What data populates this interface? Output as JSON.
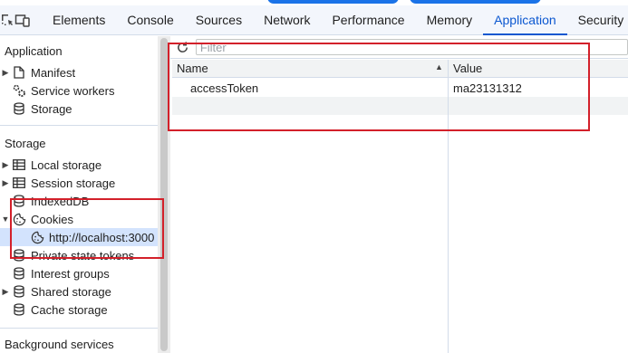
{
  "tabs": [
    {
      "label": "Elements"
    },
    {
      "label": "Console"
    },
    {
      "label": "Sources"
    },
    {
      "label": "Network"
    },
    {
      "label": "Performance"
    },
    {
      "label": "Memory"
    },
    {
      "label": "Application",
      "active": true
    },
    {
      "label": "Security"
    }
  ],
  "sidebar": {
    "application_title": "Application",
    "application_items": [
      {
        "label": "Manifest",
        "icon": "file-icon"
      },
      {
        "label": "Service workers",
        "icon": "gears-icon"
      },
      {
        "label": "Storage",
        "icon": "database-icon"
      }
    ],
    "storage_title": "Storage",
    "storage_items": [
      {
        "label": "Local storage",
        "icon": "table-icon"
      },
      {
        "label": "Session storage",
        "icon": "table-icon"
      },
      {
        "label": "IndexedDB",
        "icon": "database-icon"
      },
      {
        "label": "Cookies",
        "icon": "cookie-icon"
      },
      {
        "label": "http://localhost:3000",
        "icon": "cookie-icon"
      },
      {
        "label": "Private state tokens",
        "icon": "database-icon"
      },
      {
        "label": "Interest groups",
        "icon": "database-icon"
      },
      {
        "label": "Shared storage",
        "icon": "database-icon"
      },
      {
        "label": "Cache storage",
        "icon": "database-icon"
      }
    ],
    "background_title": "Background services"
  },
  "filter": {
    "placeholder": "Filter"
  },
  "table": {
    "headers": {
      "name": "Name",
      "value": "Value"
    },
    "rows": [
      {
        "name": "accessToken",
        "value": "ma23131312"
      }
    ]
  },
  "colors": {
    "accent": "#0b57d0",
    "highlight_box": "#d3202a",
    "selected_row": "#d3e3fd"
  }
}
